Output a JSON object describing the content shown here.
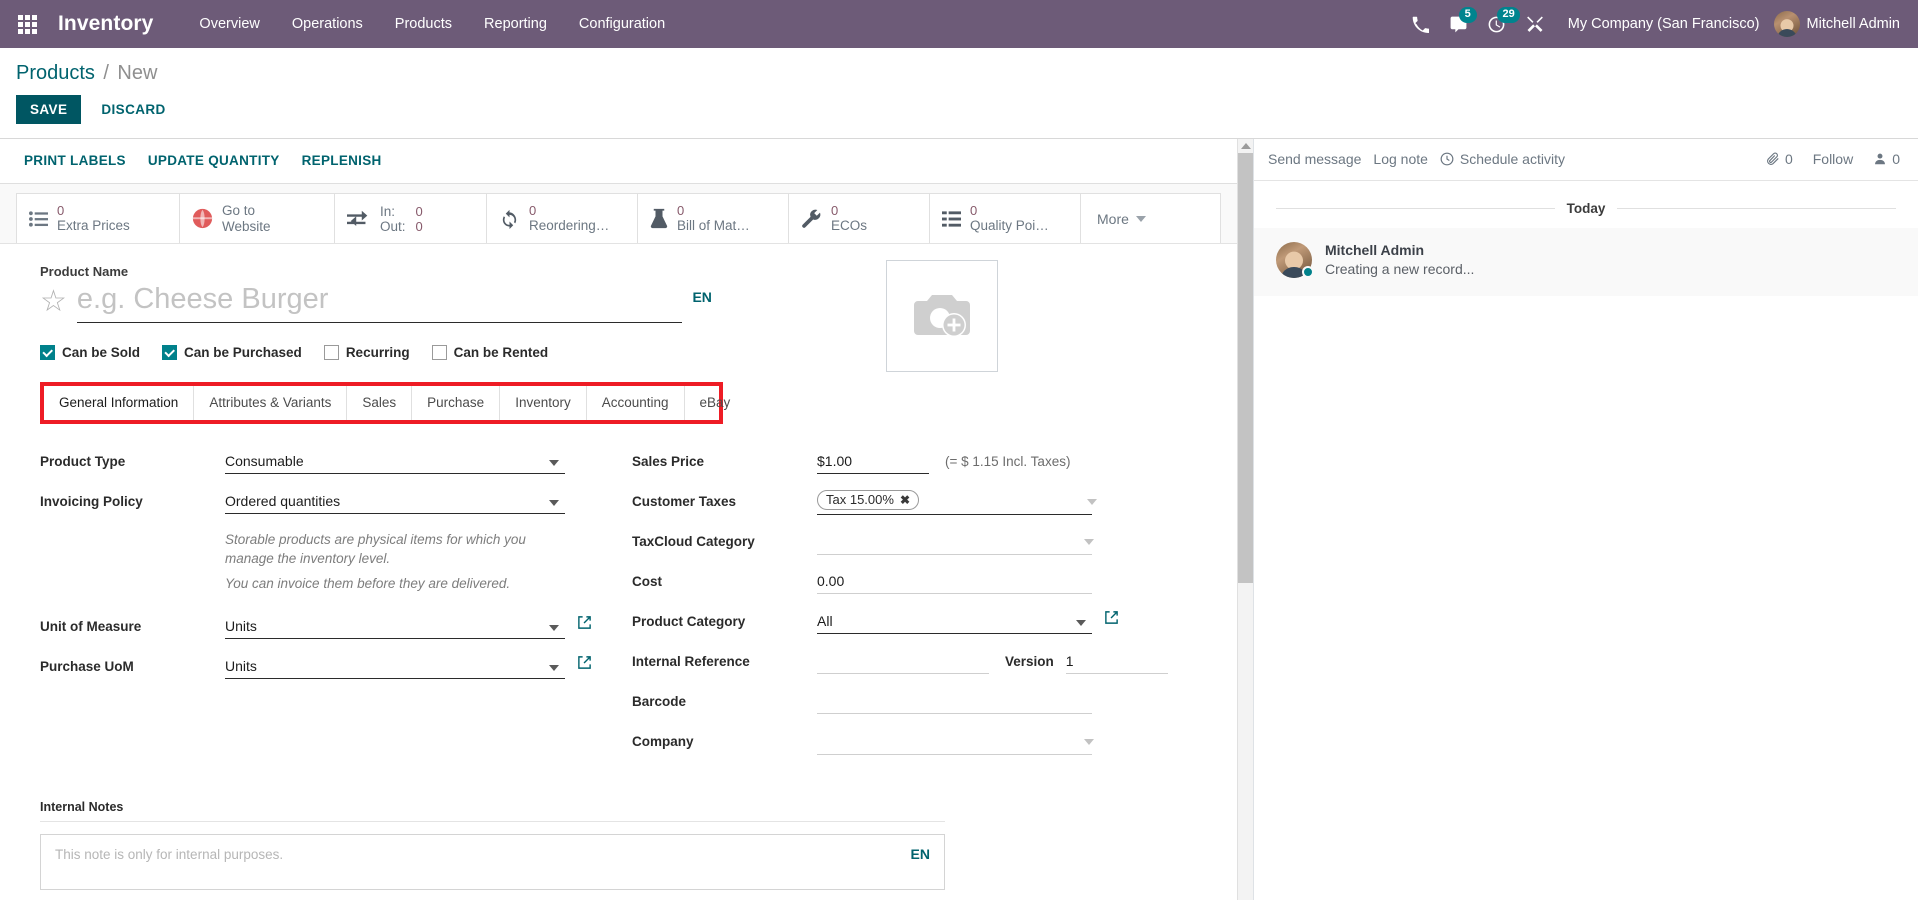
{
  "navbar": {
    "apps_icon": "apps-grid-icon",
    "brand": "Inventory",
    "menus": [
      "Overview",
      "Operations",
      "Products",
      "Reporting",
      "Configuration"
    ],
    "icons": [
      {
        "name": "phone-icon",
        "badge": null
      },
      {
        "name": "messages-icon",
        "badge": "5"
      },
      {
        "name": "activities-clock-icon",
        "badge": "29"
      },
      {
        "name": "debug-tools-icon",
        "badge": null
      }
    ],
    "company": "My Company (San Francisco)",
    "user": "Mitchell Admin"
  },
  "breadcrumb": {
    "root": "Products",
    "separator": "/",
    "current": "New"
  },
  "record_buttons": {
    "save": "SAVE",
    "discard": "DISCARD"
  },
  "action_buttons": [
    "PRINT LABELS",
    "UPDATE QUANTITY",
    "REPLENISH"
  ],
  "smart_buttons": [
    {
      "icon": "list-icon",
      "value": "0",
      "label": "Extra Prices"
    },
    {
      "icon": "globe-icon",
      "value": "",
      "label": "Go to Website",
      "label2": "Website",
      "label1": "Go to"
    },
    {
      "icon": "exchange-icon",
      "pairs": [
        {
          "k": "In:",
          "v": "0"
        },
        {
          "k": "Out:",
          "v": "0"
        }
      ]
    },
    {
      "icon": "refresh-icon",
      "value": "0",
      "label": "Reordering…"
    },
    {
      "icon": "flask-icon",
      "value": "0",
      "label": "Bill of Mat…"
    },
    {
      "icon": "wrench-icon",
      "value": "0",
      "label": "ECOs"
    },
    {
      "icon": "list-check-icon",
      "value": "0",
      "label": "Quality Poi…"
    }
  ],
  "smart_more": "More",
  "product": {
    "name_label": "Product Name",
    "name_value": "",
    "name_placeholder": "e.g. Cheese Burger",
    "lang_badge": "EN",
    "favorite_icon": "star-outline-icon",
    "image_placeholder_icon": "camera-add-icon"
  },
  "checkboxes": [
    {
      "label": "Can be Sold",
      "checked": true
    },
    {
      "label": "Can be Purchased",
      "checked": true
    },
    {
      "label": "Recurring",
      "checked": false
    },
    {
      "label": "Can be Rented",
      "checked": false
    }
  ],
  "tabs": [
    {
      "label": "General Information",
      "active": true
    },
    {
      "label": "Attributes & Variants",
      "active": false
    },
    {
      "label": "Sales",
      "active": false
    },
    {
      "label": "Purchase",
      "active": false
    },
    {
      "label": "Inventory",
      "active": false
    },
    {
      "label": "Accounting",
      "active": false
    },
    {
      "label": "eBay",
      "active": false
    }
  ],
  "tabs_highlight_color": "#ee1c25",
  "accent_color": "#00636e",
  "navbar_color": "#6d5b78",
  "form_left": {
    "product_type_label": "Product Type",
    "product_type_value": "Consumable",
    "invoicing_policy_label": "Invoicing Policy",
    "invoicing_policy_value": "Ordered quantities",
    "help_line_1": "Storable products are physical items for which you manage the inventory level.",
    "help_line_2": "You can invoice them before they are delivered.",
    "uom_label": "Unit of Measure",
    "uom_value": "Units",
    "purchase_uom_label": "Purchase UoM",
    "purchase_uom_value": "Units"
  },
  "form_right": {
    "sales_price_label": "Sales Price",
    "sales_price_value": "$1.00",
    "sales_price_hint": "(= $ 1.15 Incl. Taxes)",
    "customer_taxes_label": "Customer Taxes",
    "customer_taxes_tag": "Tax 15.00%",
    "taxcloud_label": "TaxCloud Category",
    "taxcloud_value": "",
    "cost_label": "Cost",
    "cost_value": "0.00",
    "product_category_label": "Product Category",
    "product_category_value": "All",
    "internal_reference_label": "Internal Reference",
    "internal_reference_value": "",
    "version_label": "Version",
    "version_value": "1",
    "barcode_label": "Barcode",
    "barcode_value": "",
    "company_label": "Company",
    "company_value": ""
  },
  "internal_notes": {
    "title": "Internal Notes",
    "placeholder": "This note is only for internal purposes.",
    "lang_badge": "EN"
  },
  "chatter": {
    "send_message": "Send message",
    "log_note": "Log note",
    "schedule_activity": "Schedule activity",
    "attachment_count": "0",
    "follow": "Follow",
    "follower_count": "0",
    "date_separator": "Today",
    "messages": [
      {
        "author": "Mitchell Admin",
        "body": "Creating a new record..."
      }
    ]
  }
}
